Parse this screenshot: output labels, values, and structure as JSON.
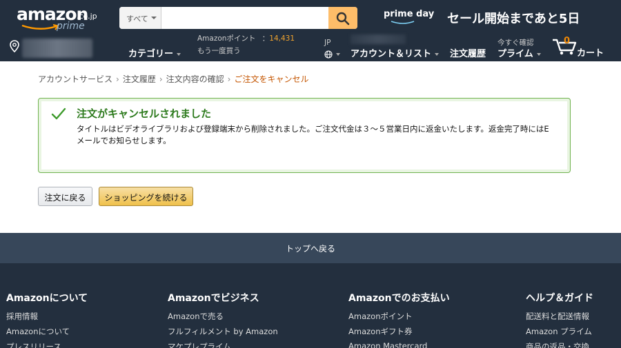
{
  "header": {
    "logo": {
      "main": "amazon",
      "tld": ".co.jp",
      "prime": "prime"
    },
    "search": {
      "category": "すべて",
      "value": "",
      "placeholder": ""
    },
    "promo": {
      "primeday": "prime day",
      "countdown": "セール開始まであと5日"
    },
    "nav": {
      "points_label": "Amazonポイント",
      "points_sep": "：",
      "points_value": "14,431",
      "buy_again": "もう一度買う",
      "categories": "カテゴリー",
      "language": "JP",
      "account": "アカウント＆リスト",
      "orders": "注文履歴",
      "prime_top": "今すぐ確認",
      "prime": "プライム",
      "cart_count": "0",
      "cart": "カート"
    }
  },
  "breadcrumb": {
    "items": [
      "アカウントサービス",
      "注文履歴",
      "注文内容の確認"
    ],
    "current": "ご注文をキャンセル",
    "separator": "›"
  },
  "alert": {
    "title": "注文がキャンセルされました",
    "body": "タイトルはビデオライブラリおよび登録端末から削除されました。ご注文代金は３～５営業日内に返金いたします。返金完了時にはEメールでお知らせします。"
  },
  "buttons": {
    "back": "注文に戻る",
    "shop": "ショッピングを続ける"
  },
  "footer": {
    "back_to_top": "トップへ戻る",
    "columns": [
      {
        "title": "Amazonについて",
        "items": [
          "採用情報",
          "Amazonについて",
          "プレスリリース"
        ]
      },
      {
        "title": "Amazonでビジネス",
        "items": [
          "Amazonで売る",
          "フルフィルメント by Amazon",
          "マケプレプライム"
        ]
      },
      {
        "title": "Amazonでのお支払い",
        "items": [
          "Amazonポイント",
          "Amazonギフト券",
          "Amazon Mastercard"
        ]
      },
      {
        "title": "ヘルプ＆ガイド",
        "items": [
          "配送料と配送情報",
          "Amazon プライム",
          "商品の返品・交換"
        ]
      }
    ]
  },
  "colors": {
    "header_bg": "#232f3e",
    "accent": "#febd69",
    "success": "#2c7a1c",
    "link_current": "#c45500"
  }
}
